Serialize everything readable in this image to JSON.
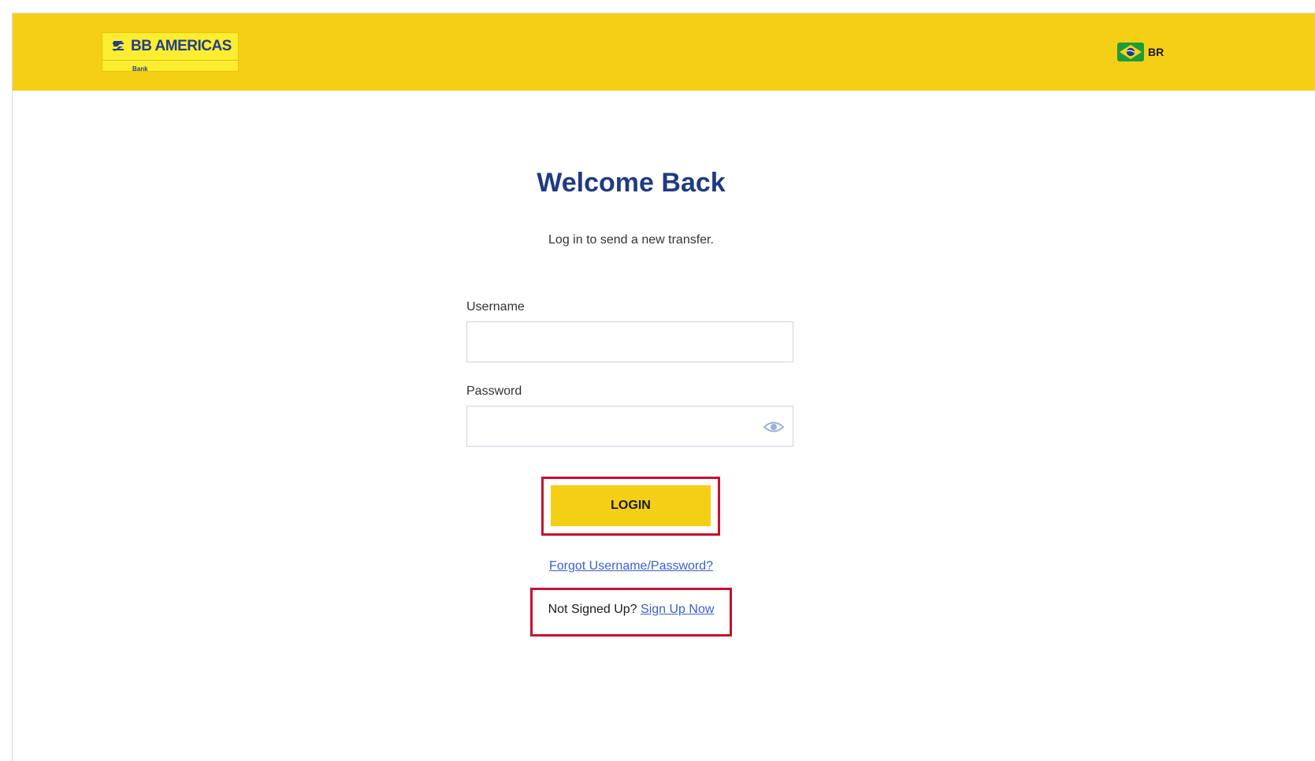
{
  "header": {
    "logo_text": "BB AMERICAS",
    "logo_sub": "Bank",
    "language_label": "BR",
    "flag_icon": "brazil-flag-icon",
    "background_color": "#f5cf16"
  },
  "main": {
    "title": "Welcome Back",
    "subtitle": "Log in to send a new transfer.",
    "username_label": "Username",
    "username_value": "",
    "password_label": "Password",
    "password_value": "",
    "password_toggle_icon": "eye-icon",
    "login_label": "LOGIN",
    "forgot_link": "Forgot Username/Password?",
    "signup_prompt": "Not Signed Up?",
    "signup_link": "Sign Up Now"
  },
  "colors": {
    "brand_yellow": "#f5cf16",
    "title_blue": "#1f3b82",
    "link_blue": "#3a5fcd",
    "highlight_red": "#c8102e"
  }
}
